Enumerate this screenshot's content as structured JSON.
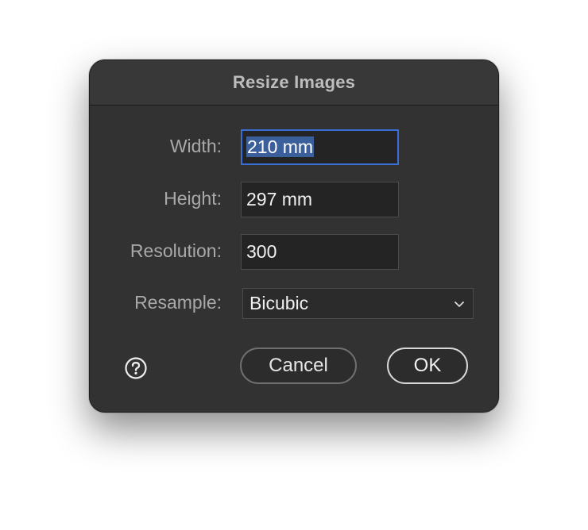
{
  "dialog": {
    "title": "Resize Images",
    "fields": {
      "width": {
        "label": "Width:",
        "value": "210 mm"
      },
      "height": {
        "label": "Height:",
        "value": "297 mm"
      },
      "resolution": {
        "label": "Resolution:",
        "value": "300"
      }
    },
    "resample": {
      "label": "Resample:",
      "selected": "Bicubic"
    },
    "buttons": {
      "cancel": "Cancel",
      "ok": "OK"
    }
  },
  "icons": {
    "help": "help-icon",
    "dropdown": "chevron-down-icon"
  },
  "colors": {
    "dialog_bg": "#323232",
    "focus_ring": "#3b6ed4",
    "selection": "#3a5f9a"
  }
}
